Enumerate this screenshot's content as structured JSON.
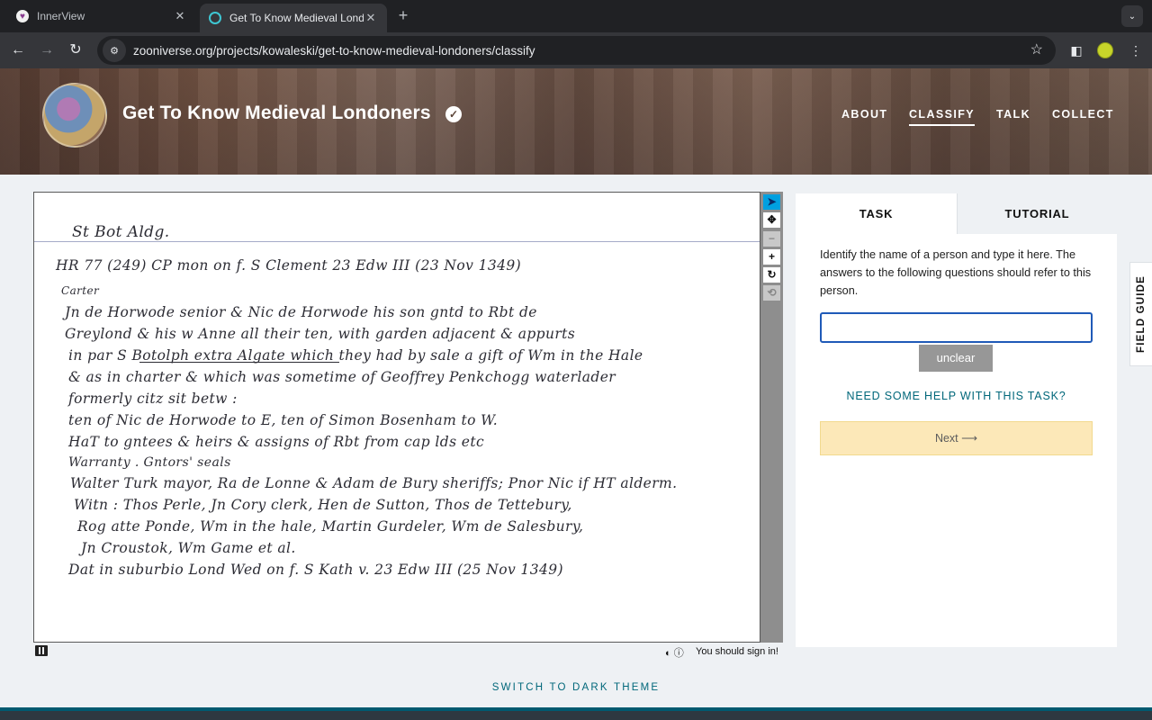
{
  "browser": {
    "tabs": [
      {
        "title": "InnerView",
        "active": false
      },
      {
        "title": "Get To Know Medieval Londo",
        "active": true
      }
    ],
    "url": "zooniverse.org/projects/kowaleski/get-to-know-medieval-londoners/classify",
    "new_tab_symbol": "+",
    "close_symbol": "✕"
  },
  "site": {
    "project_title": "Get To Know Medieval Londoners",
    "verified_symbol": "✓",
    "nav": [
      "ABOUT",
      "CLASSIFY",
      "TALK",
      "COLLECT"
    ],
    "active_nav": "CLASSIFY"
  },
  "document": {
    "header": "St Bot Aldg.",
    "lines": [
      "HR  77  (249)         CP       mon  on  f.    S  Clement  23  Edw  III     (23 Nov  1349)",
      "Carter",
      "Jn  de  Horwode    senior   &  Nic  de  Horwode   his  son   gntd  to  Rbt de",
      "Greylond  &   his     w  Anne   all    their   ten,  with   garden  adjacent  &  appurts",
      "in  par  S Botolph   extra  Algate    which  they   had   by  sale  a gift   of  Wm  in  the  Hale",
      "&  as  in  charter   &   which   was    sometime  of   Geoffrey   Penkchogg   waterlader",
      "formerly  citz        sit   betw :",
      "                ten  of   Nic  de  Horwode  to  E,     ten  of    Simon   Bosenham   to  W.",
      "HaT   to   gntees     &   heirs    &  assigns   of    Rbt     from  cap   lds  etc",
      "Warranty .    Gntors'  seals",
      "Walter  Turk  mayor,  Ra de  Lonne  &  Adam de Bury  sheriffs;  Pnor  Nic if  HT  alderm.",
      "Witn :   Thos   Perle,  Jn  Cory  clerk,   Hen  de   Sutton,   Thos  de  Tettebury,",
      " Rog   atte    Ponde,    Wm   in   the   hale,    Martin    Gurdeler,   Wm  de  Salesbury,",
      "  Jn    Croustok,    Wm   Game     et   al.",
      "Dat    in   suburbio    Lond       Wed    on    f.   S  Kath   v.     23   Edw  III   (25 Nov 1349)"
    ],
    "underlined_phrase": "S Botolph   extra  Algate"
  },
  "viewer": {
    "tools": [
      "pointer",
      "move",
      "zoom-out",
      "zoom-in",
      "rotate",
      "reset"
    ],
    "signin_note": "You should sign in!"
  },
  "task_panel": {
    "tabs": [
      "TASK",
      "TUTORIAL"
    ],
    "active_tab": "TASK",
    "instruction": "Identify the name of a person and type it here. The answers to the following questions should refer to this person.",
    "answer_value": "",
    "unclear_label": "unclear",
    "help_link": "NEED SOME HELP WITH THIS TASK?",
    "next_label": "Next ⟶"
  },
  "field_guide_label": "FIELD GUIDE",
  "theme_switch_label": "SWITCH TO DARK THEME"
}
